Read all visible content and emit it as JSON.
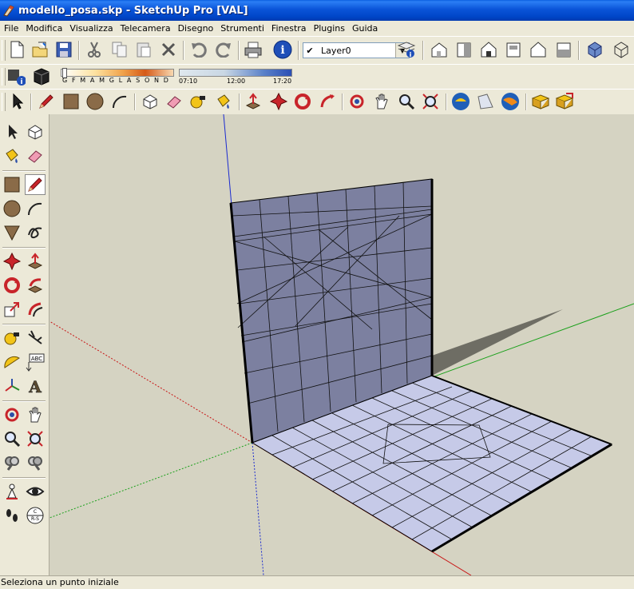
{
  "window": {
    "title": "modello_posa.skp - SketchUp Pro [VAL]",
    "title_bar_color": "#0a54d8"
  },
  "menu": {
    "items": [
      "File",
      "Modifica",
      "Visualizza",
      "Telecamera",
      "Disegno",
      "Strumenti",
      "Finestra",
      "Plugins",
      "Guida"
    ]
  },
  "toolbar": {
    "layer_checked": "✔",
    "layer_name": "Layer0",
    "icons_row1": [
      "new-file-icon",
      "open-file-icon",
      "save-icon",
      "cut-icon",
      "copy-icon",
      "paste-icon",
      "erase-icon",
      "undo-icon",
      "redo-icon",
      "print-icon",
      "model-info-icon",
      "layer-manager-icon",
      "iso-view-icon",
      "top-view-icon",
      "front-view-icon",
      "right-view-icon",
      "back-view-icon",
      "left-view-icon",
      "xray-icon",
      "wireframe-icon"
    ],
    "icons_row3": [
      "select-icon",
      "pencil-icon",
      "rectangle-icon",
      "circle-icon",
      "arc-icon",
      "make-component-icon",
      "eraser-icon",
      "tape-measure-icon",
      "paint-bucket-icon",
      "push-pull-icon",
      "move-icon",
      "rotate-icon",
      "follow-me-icon",
      "orbit-icon",
      "pan-icon",
      "zoom-icon",
      "zoom-extents-icon",
      "get-models-icon",
      "share-model-icon",
      "google-earth-icon",
      "get-photo-icon",
      "share-component-icon"
    ]
  },
  "shadow_settings": {
    "months": "G F M A M G L A S O N D",
    "time_start": "07:10",
    "time_mid": "12:00",
    "time_end": "17:20"
  },
  "left_palette": {
    "icons": [
      "select-icon",
      "make-component-icon",
      "paint-bucket-icon",
      "eraser-icon",
      "rectangle-icon",
      "line-icon",
      "circle-icon",
      "arc-icon",
      "polygon-icon",
      "freehand-icon",
      "move-icon",
      "push-pull-icon",
      "rotate-icon",
      "follow-me-icon",
      "scale-icon",
      "offset-icon",
      "tape-measure-icon",
      "dimension-icon",
      "protractor-icon",
      "text-icon",
      "axes-icon",
      "3d-text-icon",
      "orbit-icon",
      "pan-icon",
      "zoom-icon",
      "zoom-window-icon",
      "previous-view-icon",
      "next-view-icon",
      "position-camera-icon",
      "look-around-icon",
      "walk-icon",
      "section-plane-icon"
    ]
  },
  "viewport": {
    "background": "#d5d3c2",
    "face_color": "#7c80a0",
    "floor_color": "#c6cae8",
    "shadow_color": "#6e6d64"
  },
  "status": {
    "text": "Seleziona un punto iniziale"
  }
}
